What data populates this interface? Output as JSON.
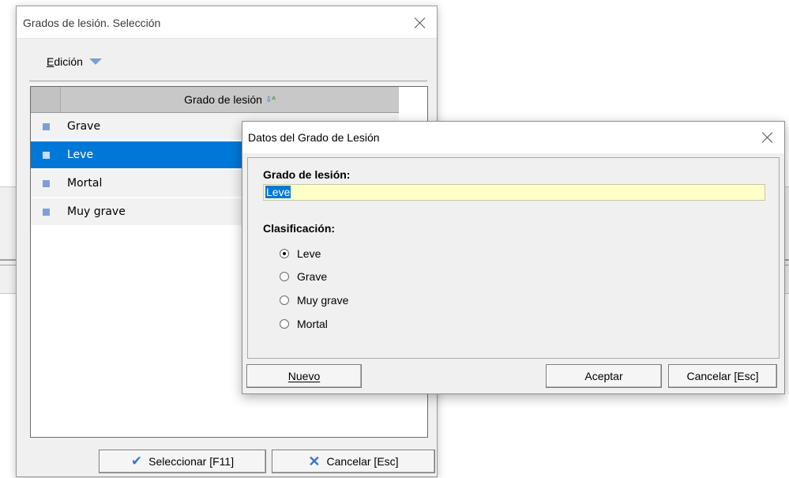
{
  "main_window": {
    "title": "Grados de lesión. Selección",
    "menu": {
      "edit_label": "Edición"
    },
    "grid": {
      "column_header": "Grado de lesión",
      "rows": [
        {
          "label": "Grave",
          "selected": false
        },
        {
          "label": "Leve",
          "selected": true
        },
        {
          "label": "Mortal",
          "selected": false
        },
        {
          "label": "Muy grave",
          "selected": false
        }
      ]
    },
    "buttons": {
      "select_label": "Seleccionar [F11]",
      "cancel_label": "Cancelar [Esc]"
    }
  },
  "dialog": {
    "title": "Datos del Grado de Lesión",
    "name_label": "Grado de lesión:",
    "name_value": "Leve",
    "classification_label": "Clasificación:",
    "options": [
      "Leve",
      "Grave",
      "Muy grave",
      "Mortal"
    ],
    "selected_option": "Leve",
    "buttons": {
      "new_label": "Nuevo",
      "accept_label": "Aceptar",
      "cancel_label": "Cancelar [Esc]"
    }
  },
  "colors": {
    "selection": "#0078d7",
    "input_bg": "#ffffc8",
    "row_indicator": "#7d9fd6",
    "accent_icon": "#3a78d0"
  }
}
